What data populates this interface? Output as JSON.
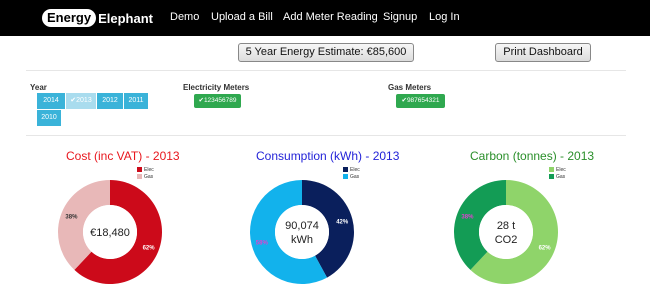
{
  "nav": {
    "brand_pill": "Energy",
    "brand_rest": "Elephant",
    "links": [
      "Demo",
      "Upload a Bill",
      "Add Meter Reading",
      "Signup",
      "Log In"
    ]
  },
  "actions": {
    "estimate": "5 Year Energy Estimate: €85,600",
    "print": "Print Dashboard"
  },
  "filters": {
    "year_label": "Year",
    "years": [
      "2014",
      "✔2013",
      "2012",
      "2011",
      "2010"
    ],
    "selected_year": "2013",
    "electricity_label": "Electricity Meters",
    "electricity_meter": "✔123456789",
    "gas_label": "Gas Meters",
    "gas_meter": "✔987654321"
  },
  "charts": [
    {
      "title": "Cost (inc VAT) - 2013",
      "title_color": "#e8171e",
      "center_line1": "€18,480",
      "center_line2": "",
      "legend": [
        {
          "label": "Elec",
          "color": "#cc0a1a"
        },
        {
          "label": "Gas",
          "color": "#e8b8b8"
        }
      ],
      "pct_elec": "62%",
      "pct_gas": "38%"
    },
    {
      "title": "Consumption (kWh) - 2013",
      "title_color": "#2323d8",
      "center_line1": "90,074",
      "center_line2": "kWh",
      "legend": [
        {
          "label": "Elec",
          "color": "#0a1f5c"
        },
        {
          "label": "Gas",
          "color": "#12b2ec"
        }
      ],
      "pct_elec": "42%",
      "pct_gas": "58%"
    },
    {
      "title": "Carbon (tonnes) - 2013",
      "title_color": "#2a8f2a",
      "center_line1": "28 t",
      "center_line2": "CO2",
      "legend": [
        {
          "label": "Elec",
          "color": "#8fd46a"
        },
        {
          "label": "Gas",
          "color": "#139c55"
        }
      ],
      "pct_elec": "62%",
      "pct_gas": "38%"
    }
  ],
  "chart_data": [
    {
      "type": "pie",
      "title": "Cost (inc VAT) - 2013",
      "categories": [
        "Elec",
        "Gas"
      ],
      "values": [
        62,
        38
      ]
    },
    {
      "type": "pie",
      "title": "Consumption (kWh) - 2013",
      "categories": [
        "Elec",
        "Gas"
      ],
      "values": [
        42,
        58
      ]
    },
    {
      "type": "pie",
      "title": "Carbon (tonnes) - 2013",
      "categories": [
        "Elec",
        "Gas"
      ],
      "values": [
        62,
        38
      ]
    }
  ]
}
